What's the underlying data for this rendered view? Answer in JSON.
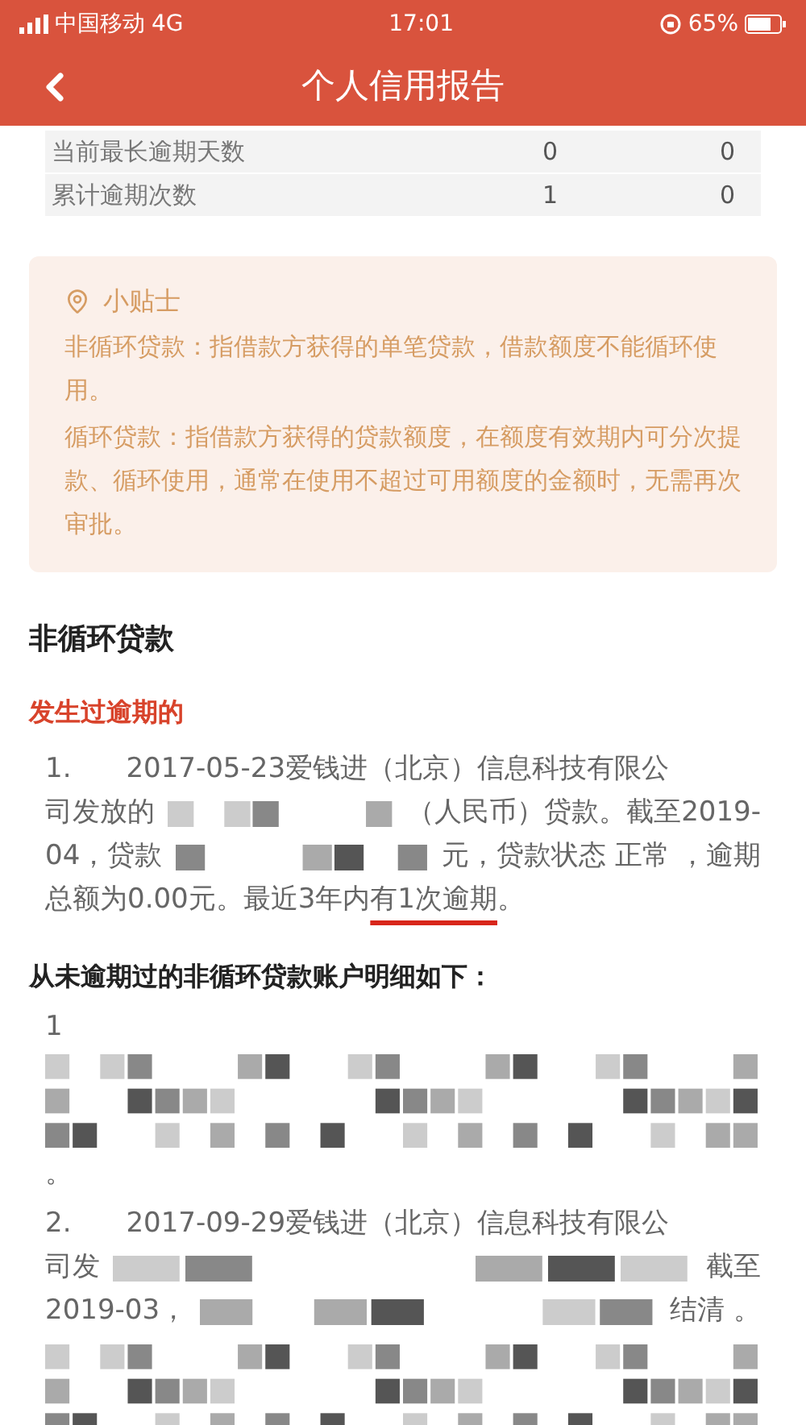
{
  "status_bar": {
    "carrier": "中国移动",
    "network": "4G",
    "time": "17:01",
    "battery": "65%"
  },
  "header": {
    "title": "个人信用报告"
  },
  "summary_table": {
    "rows": [
      {
        "label": "当前最长逾期天数",
        "values": [
          "0",
          "0"
        ]
      },
      {
        "label": "累计逾期次数",
        "values": [
          "1",
          "0"
        ]
      }
    ]
  },
  "tip": {
    "title": "小贴士",
    "paragraphs": [
      "非循环贷款：指借款方获得的单笔贷款，借款额度不能循环使用。",
      "循环贷款：指借款方获得的贷款额度，在额度有效期内可分次提款、循环使用，通常在使用不超过可用额度的金额时，无需再次审批。"
    ]
  },
  "section": {
    "title": "非循环贷款"
  },
  "overdue": {
    "heading": "发生过逾期的",
    "items": [
      {
        "lines": [
          [
            {
              "kind": "text",
              "text": "1.　　2017-05-23爱钱进（北京）信息科技有限公"
            }
          ],
          [
            {
              "kind": "text",
              "text": "司发放的"
            },
            {
              "kind": "redacted"
            },
            {
              "kind": "text",
              "text": "（人民币）贷款。截至2019-"
            }
          ],
          [
            {
              "kind": "text",
              "text": "04，贷款"
            },
            {
              "kind": "redacted"
            },
            {
              "kind": "text",
              "text": "元，贷款状态 正常 ，逾期"
            }
          ],
          [
            {
              "kind": "text",
              "text": "总额为0.00元。最近3年内"
            },
            {
              "kind": "marked",
              "text": "有1次逾期"
            },
            {
              "kind": "text",
              "text": "。"
            }
          ]
        ]
      }
    ]
  },
  "never_overdue": {
    "heading": "从未逾期过的非循环贷款账户明细如下：",
    "items": [
      {
        "lines": [
          [
            {
              "kind": "text",
              "text": "1"
            }
          ],
          [
            {
              "kind": "redacted_block"
            }
          ],
          [
            {
              "kind": "text",
              "text": "。"
            }
          ]
        ]
      },
      {
        "lines": [
          [
            {
              "kind": "text",
              "text": "2.　　2017-09-29爱钱进（北京）信息科技有限公"
            }
          ],
          [
            {
              "kind": "text",
              "text": "司发"
            },
            {
              "kind": "redacted"
            },
            {
              "kind": "text",
              "text": "截至"
            }
          ],
          [
            {
              "kind": "text",
              "text": "2019-03，"
            },
            {
              "kind": "redacted"
            },
            {
              "kind": "text",
              "text": "结清 。"
            }
          ]
        ]
      },
      {
        "lines": [
          [
            {
              "kind": "redacted_block"
            }
          ]
        ]
      }
    ]
  }
}
